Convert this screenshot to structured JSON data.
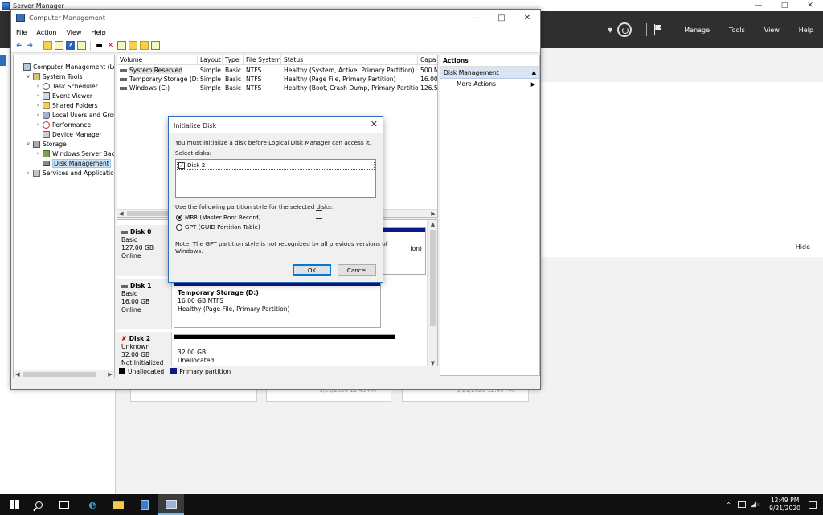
{
  "server_manager": {
    "title": "Server Manager",
    "menu": [
      "Manage",
      "Tools",
      "View",
      "Help"
    ],
    "hide_label": "Hide",
    "tile_timestamps": [
      "9/21/2020 12:49 PM",
      "9/21/2020 12:49 PM"
    ]
  },
  "computer_management": {
    "title": "Computer Management",
    "menu": [
      "File",
      "Action",
      "View",
      "Help"
    ],
    "tree": [
      {
        "label": "Computer Management (Local",
        "level": 0,
        "expander": "",
        "icon": "comp"
      },
      {
        "label": "System Tools",
        "level": 1,
        "expander": "v",
        "icon": "tools"
      },
      {
        "label": "Task Scheduler",
        "level": 2,
        "expander": ">",
        "icon": "clock"
      },
      {
        "label": "Event Viewer",
        "level": 2,
        "expander": ">",
        "icon": "viewer"
      },
      {
        "label": "Shared Folders",
        "level": 2,
        "expander": ">",
        "icon": "folder"
      },
      {
        "label": "Local Users and Groups",
        "level": 2,
        "expander": ">",
        "icon": "users"
      },
      {
        "label": "Performance",
        "level": 2,
        "expander": ">",
        "icon": "perf"
      },
      {
        "label": "Device Manager",
        "level": 2,
        "expander": "",
        "icon": "device"
      },
      {
        "label": "Storage",
        "level": 1,
        "expander": "v",
        "icon": "storage"
      },
      {
        "label": "Windows Server Backup",
        "level": 2,
        "expander": ">",
        "icon": "backup"
      },
      {
        "label": "Disk Management",
        "level": 2,
        "expander": "",
        "icon": "disk",
        "selected": true
      },
      {
        "label": "Services and Applications",
        "level": 1,
        "expander": ">",
        "icon": "services"
      }
    ],
    "volume_columns": [
      "Volume",
      "Layout",
      "Type",
      "File System",
      "Status",
      "Capa"
    ],
    "volumes": [
      {
        "volume": "System Reserved",
        "layout": "Simple",
        "type": "Basic",
        "fs": "NTFS",
        "status": "Healthy (System, Active, Primary Partition)",
        "capacity": "500 M"
      },
      {
        "volume": "Temporary Storage (D:)",
        "layout": "Simple",
        "type": "Basic",
        "fs": "NTFS",
        "status": "Healthy (Page File, Primary Partition)",
        "capacity": "16.00"
      },
      {
        "volume": "Windows (C:)",
        "layout": "Simple",
        "type": "Basic",
        "fs": "NTFS",
        "status": "Healthy (Boot, Crash Dump, Primary Partition)",
        "capacity": "126.5"
      }
    ],
    "disks": [
      {
        "name": "Disk 0",
        "kind": "Basic",
        "size": "127.00 GB",
        "state": "Online",
        "partition_title": "",
        "partition_size": "",
        "partition_status": "ion)",
        "bar_color": "#0a1a8a"
      },
      {
        "name": "Disk 1",
        "kind": "Basic",
        "size": "16.00 GB",
        "state": "Online",
        "partition_title": "Temporary Storage  (D:)",
        "partition_size": "16.00 GB NTFS",
        "partition_status": "Healthy (Page File, Primary Partition)",
        "bar_color": "#0a1a8a"
      },
      {
        "name": "Disk 2",
        "kind": "Unknown",
        "size": "32.00 GB",
        "state": "Not Initialized",
        "partition_title": "",
        "partition_size": "32.00 GB",
        "partition_status": "Unallocated",
        "bar_color": "#000000"
      }
    ],
    "legend": {
      "unallocated": "Unallocated",
      "primary": "Primary partition"
    },
    "actions": {
      "title": "Actions",
      "section": "Disk Management",
      "items": [
        "More Actions"
      ]
    }
  },
  "dialog": {
    "title": "Initialize Disk",
    "intro": "You must initialize a disk before Logical Disk Manager can access it.",
    "select_label": "Select disks:",
    "disk_item": "Disk 2",
    "style_label": "Use the following partition style for the selected disks:",
    "mbr_label": "MBR (Master Boot Record)",
    "gpt_label": "GPT (GUID Partition Table)",
    "note_line1": "Note: The GPT partition style is not recognized by all previous versions of",
    "note_line2": "Windows.",
    "ok_label": "OK",
    "cancel_label": "Cancel",
    "selected_style": "MBR"
  },
  "taskbar": {
    "time": "12:49 PM",
    "date": "9/21/2020"
  }
}
